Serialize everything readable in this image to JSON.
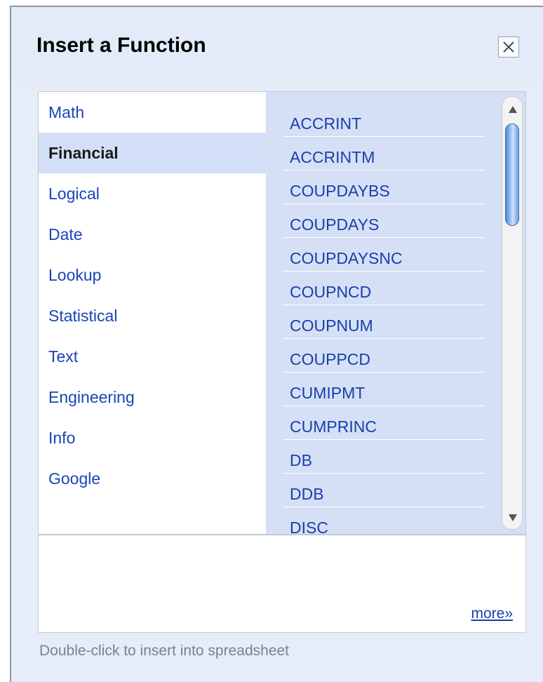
{
  "dialog": {
    "title": "Insert a Function",
    "close_icon": "close-icon"
  },
  "categories": [
    {
      "label": "Math",
      "selected": false
    },
    {
      "label": "Financial",
      "selected": true
    },
    {
      "label": "Logical",
      "selected": false
    },
    {
      "label": "Date",
      "selected": false
    },
    {
      "label": "Lookup",
      "selected": false
    },
    {
      "label": "Statistical",
      "selected": false
    },
    {
      "label": "Text",
      "selected": false
    },
    {
      "label": "Engineering",
      "selected": false
    },
    {
      "label": "Info",
      "selected": false
    },
    {
      "label": "Google",
      "selected": false
    }
  ],
  "functions": [
    "ACCRINT",
    "ACCRINTM",
    "COUPDAYBS",
    "COUPDAYS",
    "COUPDAYSNC",
    "COUPNCD",
    "COUPNUM",
    "COUPPCD",
    "CUMIPMT",
    "CUMPRINC",
    "DB",
    "DDB",
    "DISC"
  ],
  "description": {
    "more_label": "more»"
  },
  "footer": {
    "hint": "Double-click to insert into spreadsheet"
  },
  "colors": {
    "selected_background": "#d3dff6",
    "list_background": "#d5e0f6",
    "link": "#1a3fa8"
  }
}
